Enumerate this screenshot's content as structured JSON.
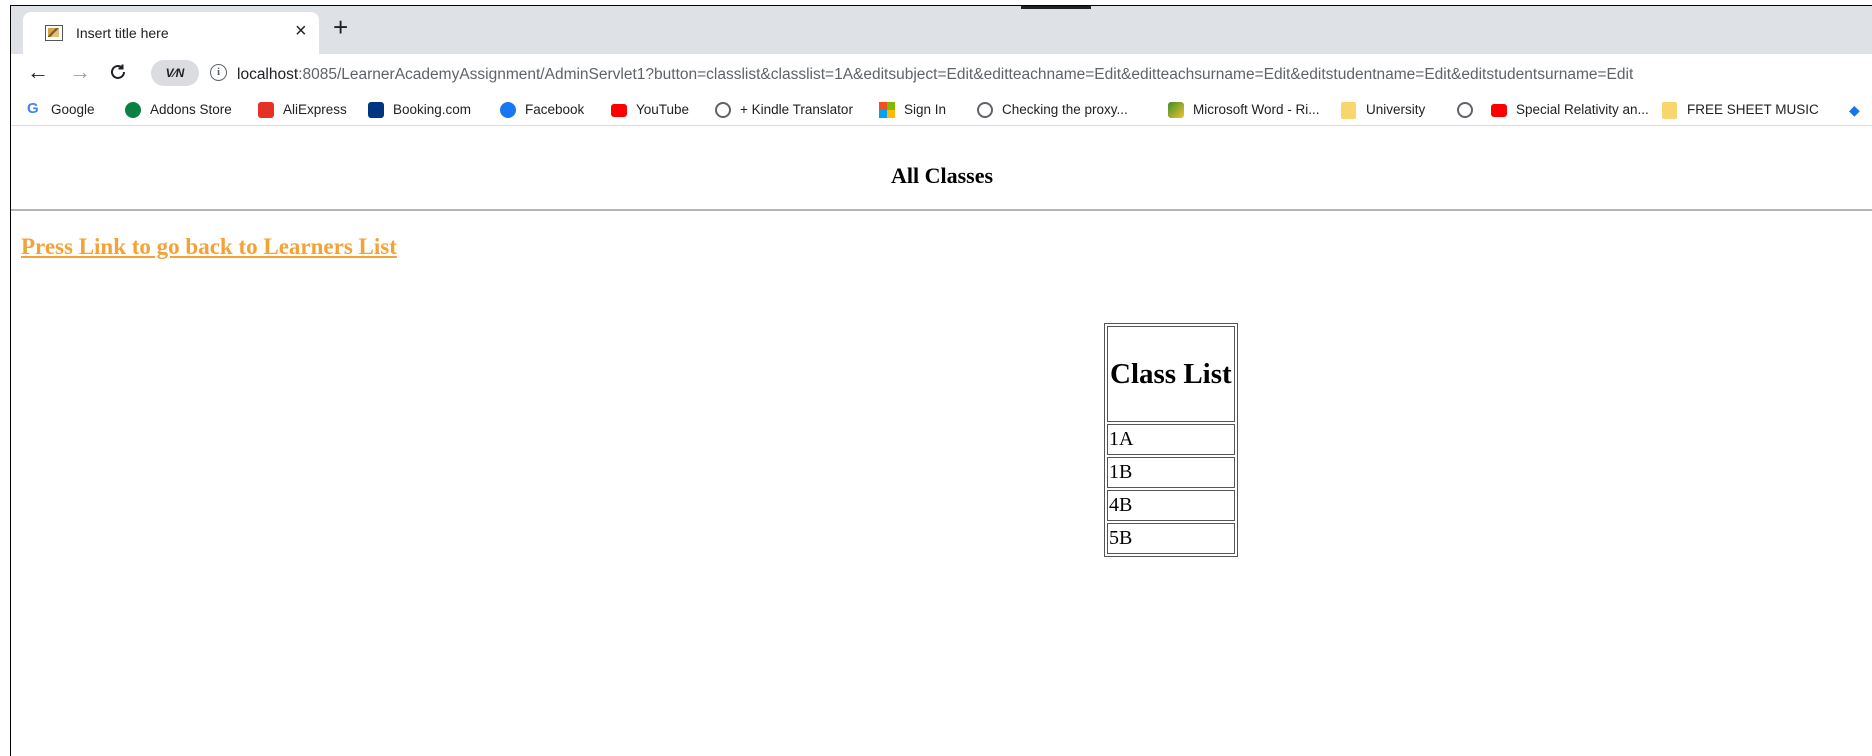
{
  "browser": {
    "tab": {
      "title": "Insert title here",
      "close_glyph": "×"
    },
    "new_tab_glyph": "+",
    "toolbar": {
      "back_glyph": "←",
      "forward_glyph": "→",
      "reload_glyph": "C",
      "extension_label": "V⁄N",
      "info_glyph": "i",
      "url_host": "localhost",
      "url_rest": ":8085/LearnerAcademyAssignment/AdminServlet1?button=classlist&classlist=1A&editsubject=Edit&editteachname=Edit&editteachsurname=Edit&editstudentname=Edit&editstudentsurname=Edit"
    },
    "bookmarks": [
      {
        "label": "Google",
        "icon": "google-icon"
      },
      {
        "label": "Addons Store",
        "icon": "addons-store-icon"
      },
      {
        "label": "AliExpress",
        "icon": "aliexpress-icon"
      },
      {
        "label": "Booking.com",
        "icon": "booking-icon"
      },
      {
        "label": "Facebook",
        "icon": "facebook-icon"
      },
      {
        "label": "YouTube",
        "icon": "youtube-icon"
      },
      {
        "label": "+ Kindle Translator",
        "icon": "globe-icon"
      },
      {
        "label": "Sign In",
        "icon": "microsoft-icon"
      },
      {
        "label": "Checking the proxy...",
        "icon": "globe-icon"
      },
      {
        "label": "Microsoft Word - Ri...",
        "icon": "word-doc-icon"
      },
      {
        "label": "University",
        "icon": "folder-icon"
      },
      {
        "label": "",
        "icon": "globe-icon"
      },
      {
        "label": "Special Relativity an...",
        "icon": "youtube-icon"
      },
      {
        "label": "FREE SHEET MUSIC",
        "icon": "folder-icon"
      }
    ]
  },
  "page": {
    "title": "All Classes",
    "back_link": "Press Link to go back to Learners List",
    "table": {
      "header": "Class List",
      "rows": [
        "1A",
        "1B",
        "4B",
        "5B"
      ]
    }
  },
  "colors": {
    "link": "#f4a235",
    "tabstrip": "#dee1e6",
    "youtube_red": "#ff0000",
    "facebook_blue": "#1877f2",
    "aliexpress_red": "#e43225",
    "booking_navy": "#003580",
    "addons_green": "#0b8043"
  }
}
